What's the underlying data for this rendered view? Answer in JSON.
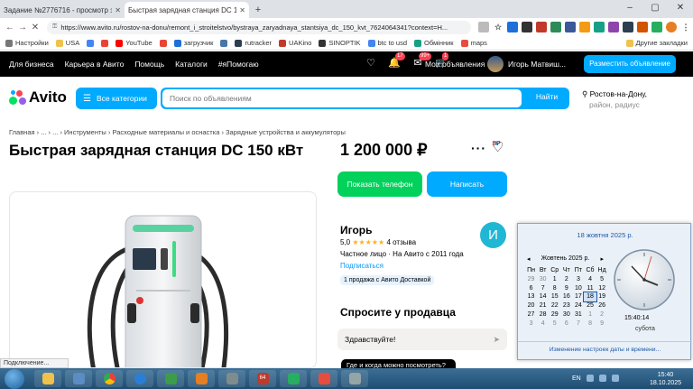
{
  "browser": {
    "tabs": [
      {
        "icon": "SP",
        "title": "Задание №2776716 - просмотр з"
      },
      {
        "icon": "A",
        "title": "Быстрая зарядная станция DC 15"
      }
    ],
    "url": "https://www.avito.ru/rostov-na-donu/remont_i_stroitelstvo/bystraya_zaryadnaya_stantsiya_dc_150_kvt_7624064341?context=H..."
  },
  "bookmarks": [
    "Настройки",
    "USA",
    "YouTube",
    "загрузчик",
    "rutracker",
    "UAKino",
    "SINOPTIK",
    "btc to usd",
    "Обмінник",
    "maps"
  ],
  "bookmarks_other": "Другие закладки",
  "topnav": {
    "links": [
      "Для бизнеса",
      "Карьера в Авито",
      "Помощь",
      "Каталоги",
      "#яПомогаю"
    ],
    "badges": [
      "17",
      "99+",
      "1"
    ],
    "my_ads": "Мои объявления",
    "user": "Игорь Матвиш...",
    "place_ad": "Разместить объявление"
  },
  "logo": "Avito",
  "search": {
    "categories_label": "Все категории",
    "placeholder": "Поиск по объявлениям",
    "find_label": "Найти",
    "location": "Ростов-на-Дону,",
    "location_sub": "район, радиус"
  },
  "breadcrumbs": "Главная  ›  ...  ›  ...  ›  Инструменты  ›  Расходные материалы и оснастка  ›  Зарядные устройства и аккумуляторы",
  "listing": {
    "title": "Быстрая зарядная станция DC 150 кВт",
    "price": "1 200 000 ₽",
    "phone_button": "Показать телефон",
    "write_button": "Написать"
  },
  "seller": {
    "name": "Игорь",
    "rating": "5,0",
    "stars": "★★★★★",
    "reviews": "4 отзыва",
    "info": "Частное лицо · На Авито с 2011 года",
    "subscribe": "Подписаться",
    "delivery": "1 продажа с Авито Доставкой",
    "avatar_letter": "И"
  },
  "ask": {
    "heading": "Спросите у продавца",
    "message": "Здравствуйте!",
    "chip": "Где и когда можно посмотреть?"
  },
  "calendar": {
    "header": "18 жовтня 2025 р.",
    "month": "Жовтень 2025 р.",
    "days_of_week": [
      "Пн",
      "Вт",
      "Ср",
      "Чт",
      "Пт",
      "Сб",
      "Нд"
    ],
    "weeks": [
      [
        "29",
        "30",
        "1",
        "2",
        "3",
        "4",
        "5"
      ],
      [
        "6",
        "7",
        "8",
        "9",
        "10",
        "11",
        "12"
      ],
      [
        "13",
        "14",
        "15",
        "16",
        "17",
        "18",
        "19"
      ],
      [
        "20",
        "21",
        "22",
        "23",
        "24",
        "25",
        "26"
      ],
      [
        "27",
        "28",
        "29",
        "30",
        "31",
        "1",
        "2"
      ],
      [
        "3",
        "4",
        "5",
        "6",
        "7",
        "8",
        "9"
      ]
    ],
    "clock_time": "15:40:14",
    "clock_day": "субота",
    "footer": "Изменение настроек даты и времени..."
  },
  "status_text": "Подключение...",
  "taskbar": {
    "lang": "EN",
    "time": "15:40",
    "date": "18.10.2025",
    "app_64_label": "64"
  },
  "colors": {
    "avito_blue": "#00aaff",
    "avito_green": "#02d15c",
    "nav_black": "#000000",
    "badge_red": "#ff4053"
  }
}
